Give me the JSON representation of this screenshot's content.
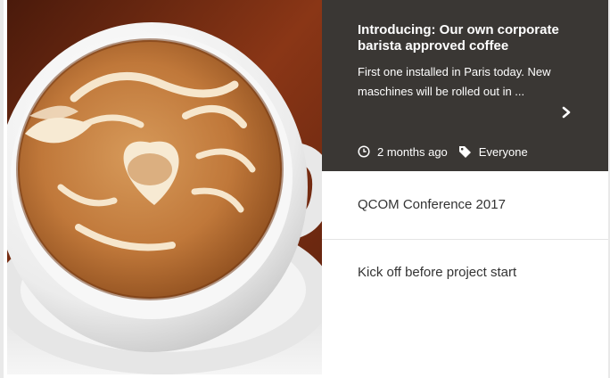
{
  "featured": {
    "title": "Introducing: Our own corporate barista approved coffee",
    "excerpt": "First one installed in Paris today. New maschines will be rolled out in ...",
    "time_ago": "2 months ago",
    "audience": "Everyone",
    "panel_color": "#3a3734",
    "icons": {
      "time": "clock-icon",
      "audience": "tag-icon",
      "next": "chevron-right-icon"
    }
  },
  "news_items": [
    {
      "title": "QCOM Conference 2017"
    },
    {
      "title": "Kick off before project start"
    }
  ]
}
